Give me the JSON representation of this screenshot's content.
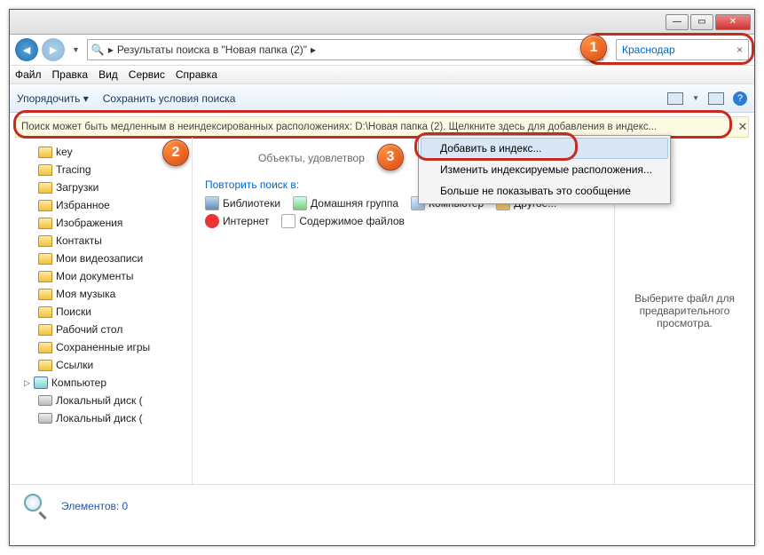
{
  "titlebar": {
    "min": "—",
    "max": "▭",
    "close": "✕"
  },
  "nav": {
    "address": "Результаты поиска в \"Новая папка (2)\"",
    "search_value": "Краснодар",
    "clear": "×"
  },
  "menubar": [
    "Файл",
    "Правка",
    "Вид",
    "Сервис",
    "Справка"
  ],
  "toolbar": {
    "organize": "Упорядочить ▾",
    "save_search": "Сохранить условия поиска",
    "help": "?"
  },
  "warning": {
    "text": "Поиск может быть медленным в неиндексированных расположениях: D:\\Новая папка (2). Щелкните здесь для добавления в индекс...",
    "close": "✕"
  },
  "context_menu": {
    "items": [
      "Добавить в индекс...",
      "Изменить индексируемые расположения...",
      "Больше не показывать это сообщение"
    ]
  },
  "sidebar": {
    "items": [
      "key",
      "Tracing",
      "Загрузки",
      "Избранное",
      "Изображения",
      "Контакты",
      "Мои видеозаписи",
      "Мои документы",
      "Моя музыка",
      "Поиски",
      "Рабочий стол",
      "Сохраненные игры",
      "Ссылки"
    ],
    "computer": "Компьютер",
    "disks": [
      "Локальный диск (",
      "Локальный диск ("
    ]
  },
  "content": {
    "no_results": "Объекты, удовлетвор",
    "repeat_in": "Повторить поиск в:",
    "links_row1": [
      {
        "label": "Библиотеки",
        "icon": "lib"
      },
      {
        "label": "Домашняя группа",
        "icon": "home"
      },
      {
        "label": "Компьютер",
        "icon": "pc"
      },
      {
        "label": "Другое...",
        "icon": "other"
      }
    ],
    "links_row2": [
      {
        "label": "Интернет",
        "icon": "net"
      },
      {
        "label": "Содержимое файлов",
        "icon": "file"
      }
    ]
  },
  "preview": "Выберите файл для предварительного просмотра.",
  "statusbar": {
    "count": "Элементов: 0"
  },
  "badges": {
    "b1": "1",
    "b2": "2",
    "b3": "3"
  }
}
